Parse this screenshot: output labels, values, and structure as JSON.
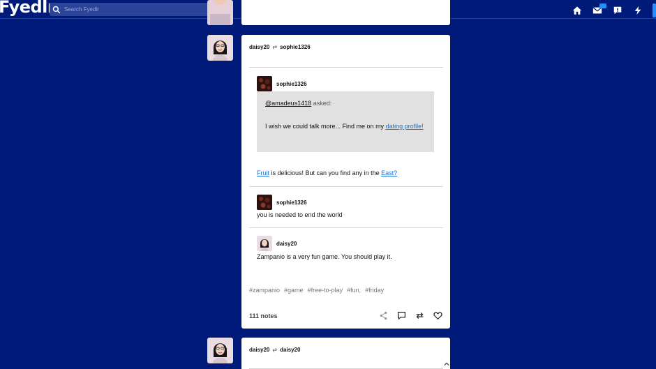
{
  "header": {
    "logo": "Fyedlr",
    "search_placeholder": "Search Fyedlr"
  },
  "posts": [
    {
      "author": "daisy20",
      "reblogged_from": "sophie1326",
      "trail": [
        {
          "user": "sophie1326",
          "ask": {
            "asker": "@amadeus1418",
            "asked_label": "asked:",
            "question_text": "I wish we could talk more... Find me on my ",
            "question_link": "dating profile!"
          },
          "body_link1": "Fruit",
          "body_mid": " is delicious! But can you find any in the ",
          "body_link2": "East?"
        },
        {
          "user": "sophie1326",
          "body": "you is needed to end the world"
        },
        {
          "user": "daisy20",
          "body": "Zampanio is a very fun game. You should play it."
        }
      ],
      "tags": [
        "#zampanio",
        "#game",
        "#free-to-play",
        "#fun,",
        "#friday"
      ],
      "notes": "111 notes"
    },
    {
      "author": "daisy20",
      "reblogged_from": "daisy20"
    }
  ]
}
